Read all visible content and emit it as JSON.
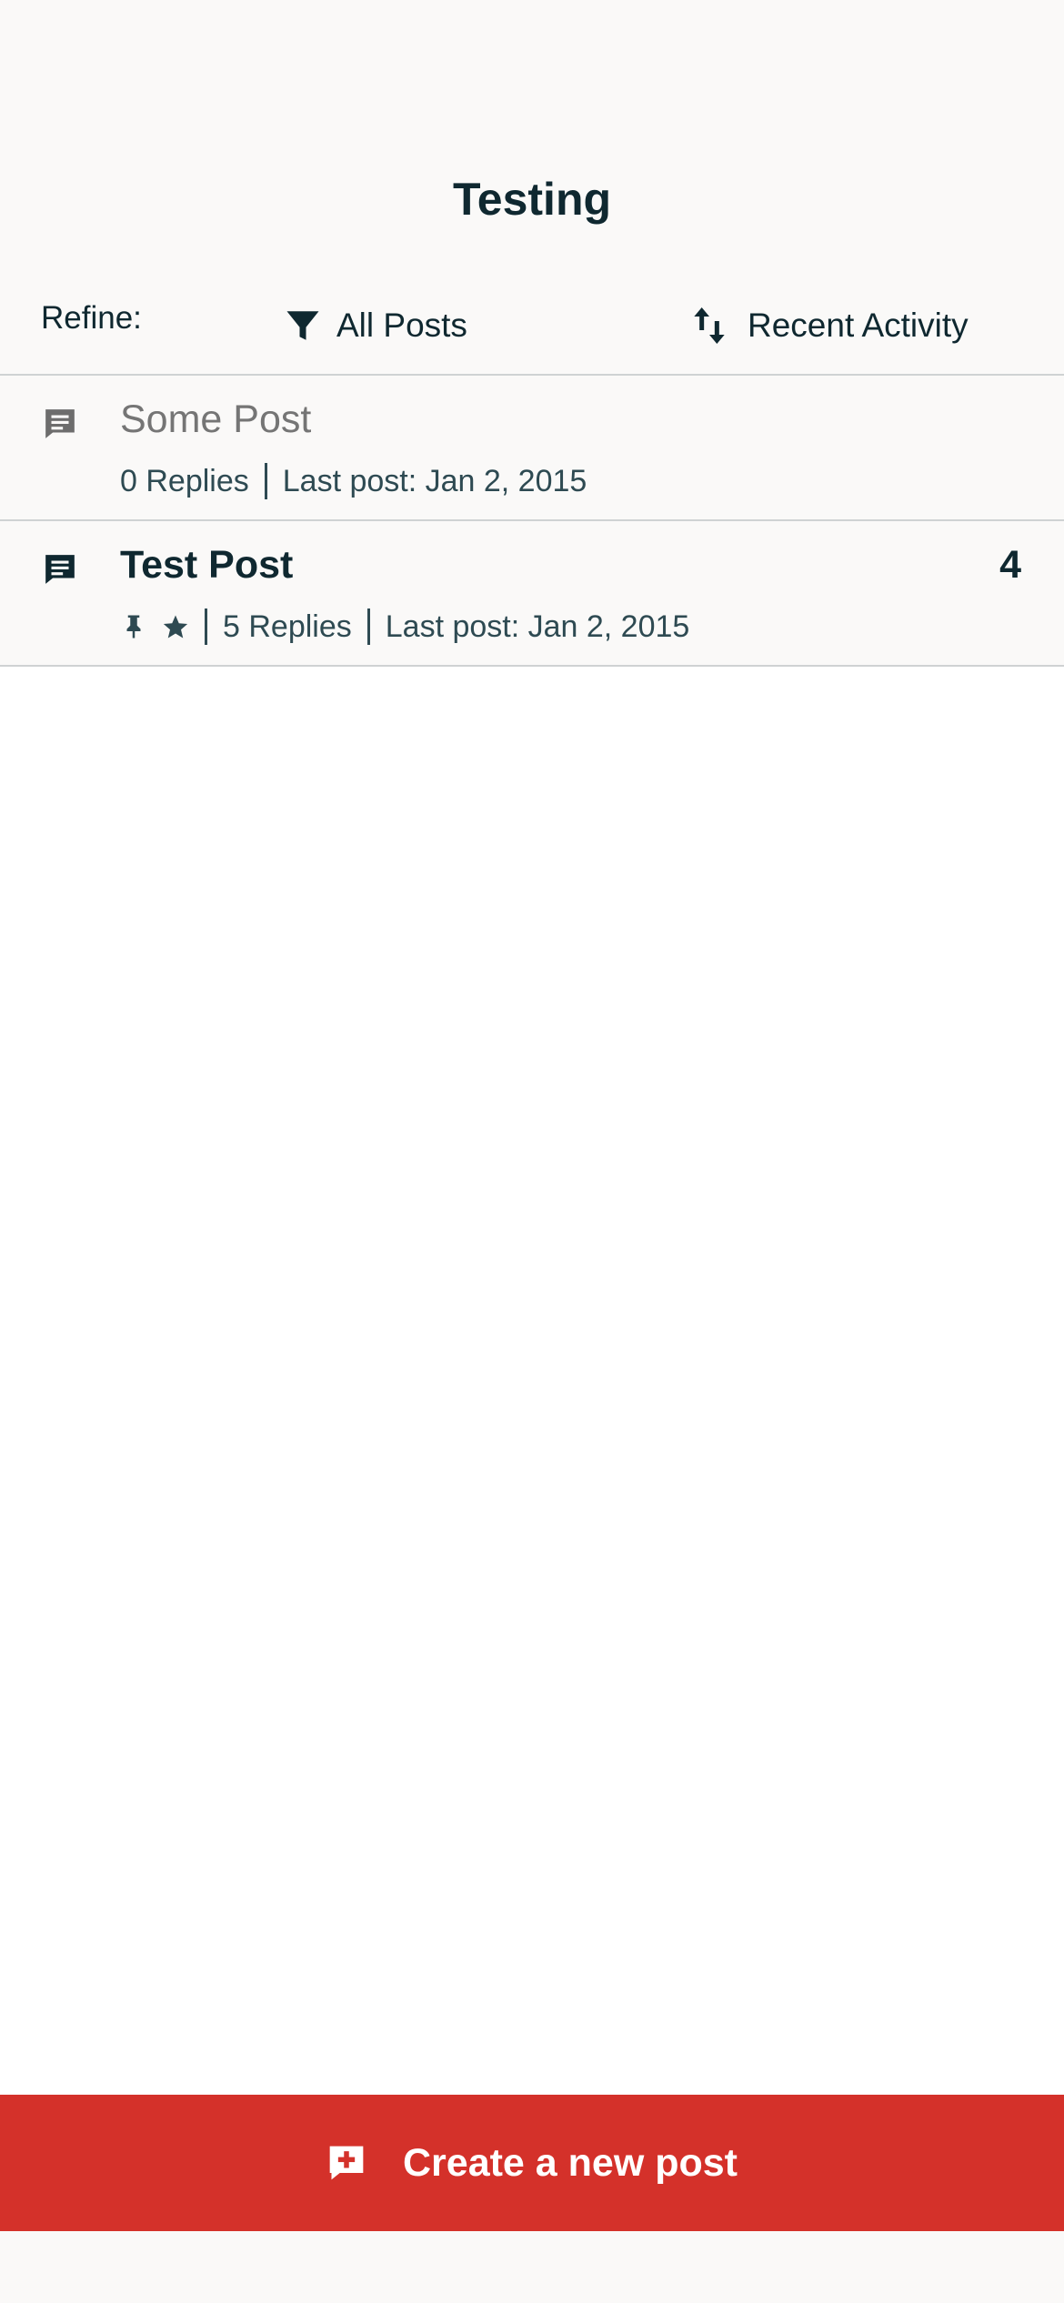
{
  "page": {
    "title": "Testing"
  },
  "refine": {
    "label": "Refine:",
    "filter_label": "All Posts",
    "filter_icon": "funnel-icon",
    "sort_label": "Recent Activity",
    "sort_icon": "sort-arrows-icon"
  },
  "posts": [
    {
      "title": "Some Post",
      "state": "read",
      "icon": "comment-icon",
      "replies": "0 Replies",
      "last_post": "Last post: Jan 2, 2015"
    },
    {
      "title": "Test Post",
      "state": "unread",
      "icon": "comment-icon",
      "pinned": true,
      "starred": true,
      "replies": "5 Replies",
      "last_post": "Last post: Jan 2, 2015",
      "unread_count": "4"
    }
  ],
  "create_button": {
    "label": "Create a new post",
    "icon": "add-comment-icon"
  },
  "colors": {
    "accent": "#d4312a",
    "header_bg": "#faf9f8",
    "text_primary": "#0f2830",
    "text_muted": "#757575",
    "divider": "#cfd2d3"
  }
}
